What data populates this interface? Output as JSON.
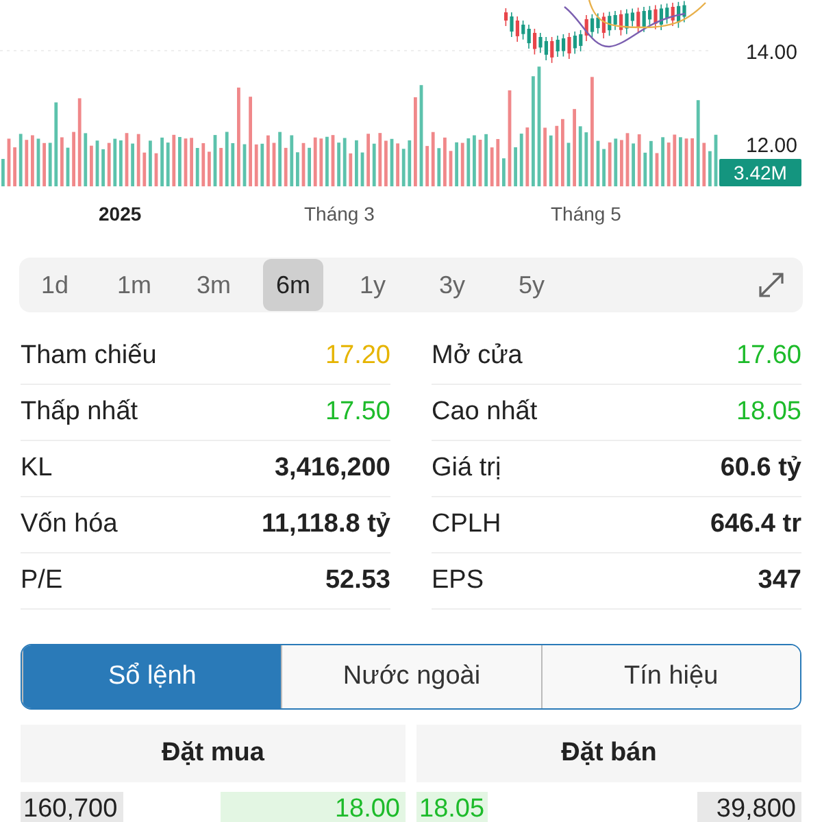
{
  "chart": {
    "price_labels": [
      "14.00",
      "12.00"
    ],
    "volume_badge": "3.42M",
    "axis_labels": [
      {
        "text": "2025",
        "bold": true
      },
      {
        "text": "Tháng 3",
        "bold": false
      },
      {
        "text": "Tháng 5",
        "bold": false
      }
    ]
  },
  "periods": [
    {
      "label": "1d",
      "selected": false
    },
    {
      "label": "1m",
      "selected": false
    },
    {
      "label": "3m",
      "selected": false
    },
    {
      "label": "6m",
      "selected": true
    },
    {
      "label": "1y",
      "selected": false
    },
    {
      "label": "3y",
      "selected": false
    },
    {
      "label": "5y",
      "selected": false
    }
  ],
  "stats": [
    {
      "label": "Tham chiếu",
      "value": "17.20",
      "color": "#e6b400"
    },
    {
      "label": "Mở cửa",
      "value": "17.60",
      "color": "#1dbb2a"
    },
    {
      "label": "Thấp nhất",
      "value": "17.50",
      "color": "#1dbb2a"
    },
    {
      "label": "Cao nhất",
      "value": "18.05",
      "color": "#1dbb2a"
    },
    {
      "label": "KL",
      "value": "3,416,200",
      "color": "#222222"
    },
    {
      "label": "Giá trị",
      "value": "60.6 tỷ",
      "color": "#222222"
    },
    {
      "label": "Vốn hóa",
      "value": "11,118.8 tỷ",
      "color": "#222222"
    },
    {
      "label": "CPLH",
      "value": "646.4 tr",
      "color": "#222222"
    },
    {
      "label": "P/E",
      "value": "52.53",
      "color": "#222222"
    },
    {
      "label": "EPS",
      "value": "347",
      "color": "#222222"
    }
  ],
  "tabs": [
    {
      "label": "Sổ lệnh",
      "selected": true
    },
    {
      "label": "Nước ngoài",
      "selected": false
    },
    {
      "label": "Tín hiệu",
      "selected": false
    }
  ],
  "order_book": {
    "headers": [
      "Đặt mua",
      "Đặt bán"
    ],
    "rows": [
      {
        "bid_volume": "160,700",
        "bid_price": "18.00",
        "ask_price": "18.05",
        "ask_volume": "39,800"
      }
    ]
  }
}
